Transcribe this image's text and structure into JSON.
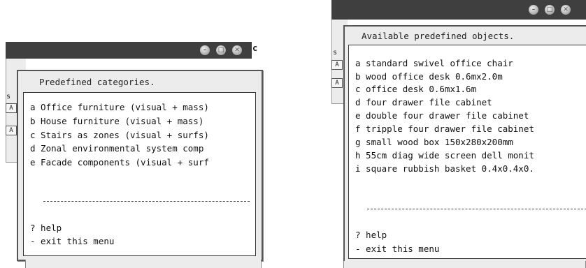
{
  "left_window": {
    "title_suffix": "c",
    "side_labels": [
      "s"
    ],
    "side_tabs": [
      "A",
      "A"
    ],
    "menu_title": "Predefined categories.",
    "items": [
      "a Office furniture (visual + mass)",
      "b House furniture (visual + mass)",
      "c Stairs as zones (visual + surfs)",
      "d Zonal environmental system comp",
      "e Facade components (visual + surf"
    ],
    "separator": "-----------------------------------",
    "help": "? help",
    "exit": "- exit this menu"
  },
  "right_window": {
    "side_labels": [
      "s"
    ],
    "side_tabs": [
      "A",
      "A"
    ],
    "menu_title": "Available predefined objects.",
    "items": [
      "a standard swivel office chair",
      "b wood office desk 0.6mx2.0m",
      "c office desk 0.6mx1.6m",
      "d four drawer file cabinet",
      "e double four drawer file cabinet",
      "f tripple four drawer file cabinet",
      "g small wood box 150x280x200mm",
      "h 55cm diag wide screen dell monit",
      "i square rubbish basket 0.4x0.4x0."
    ],
    "separator": "-----------------------------------",
    "help": "? help",
    "exit": "- exit this menu"
  },
  "titlebar_buttons": [
    "minimize",
    "maximize",
    "close"
  ],
  "colors": {
    "titlebar": "#3f3f3f",
    "panel": "#ececec",
    "menu_bg": "#ffffff",
    "text": "#111111"
  }
}
